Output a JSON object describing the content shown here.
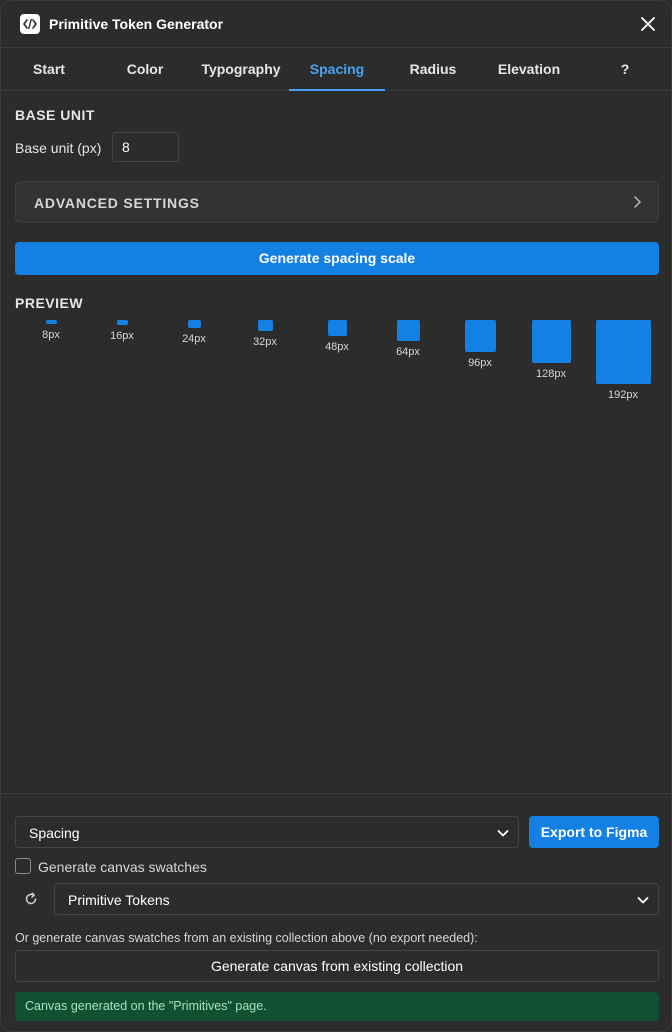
{
  "window": {
    "title": "Primitive Token Generator"
  },
  "tabs": [
    {
      "label": "Start"
    },
    {
      "label": "Color"
    },
    {
      "label": "Typography"
    },
    {
      "label": "Spacing"
    },
    {
      "label": "Radius"
    },
    {
      "label": "Elevation"
    },
    {
      "label": "?"
    }
  ],
  "active_tab": "Spacing",
  "base_unit": {
    "section_title": "BASE UNIT",
    "field_label": "Base unit (px)",
    "value": "8"
  },
  "advanced": {
    "label": "ADVANCED SETTINGS"
  },
  "generate_button": "Generate spacing scale",
  "preview": {
    "title": "PREVIEW",
    "swatches": [
      {
        "value": 8,
        "label": "8px"
      },
      {
        "value": 16,
        "label": "16px"
      },
      {
        "value": 24,
        "label": "24px"
      },
      {
        "value": 32,
        "label": "32px"
      },
      {
        "value": 48,
        "label": "48px"
      },
      {
        "value": 64,
        "label": "64px"
      },
      {
        "value": 96,
        "label": "96px"
      },
      {
        "value": 128,
        "label": "128px"
      },
      {
        "value": 192,
        "label": "192px"
      }
    ]
  },
  "export": {
    "type_select": "Spacing",
    "export_button": "Export to Figma",
    "canvas_checkbox_label": "Generate canvas swatches",
    "canvas_checkbox_checked": false,
    "collection_select": "Primitive Tokens",
    "hint": "Or generate canvas swatches from an existing collection above (no export needed):",
    "existing_button": "Generate canvas from existing collection",
    "status": "Canvas generated on the \"Primitives\" page."
  },
  "colors": {
    "accent": "#1480e3",
    "tab_active": "#4aa3f0",
    "background": "#2c2c2c",
    "status_bg": "#0f5132",
    "status_text": "#a5e3bf"
  },
  "icons": {
    "app": "code-icon",
    "close": "close-icon",
    "advanced": "chevron-right-icon",
    "select": "chevron-down-icon",
    "refresh": "refresh-icon"
  }
}
